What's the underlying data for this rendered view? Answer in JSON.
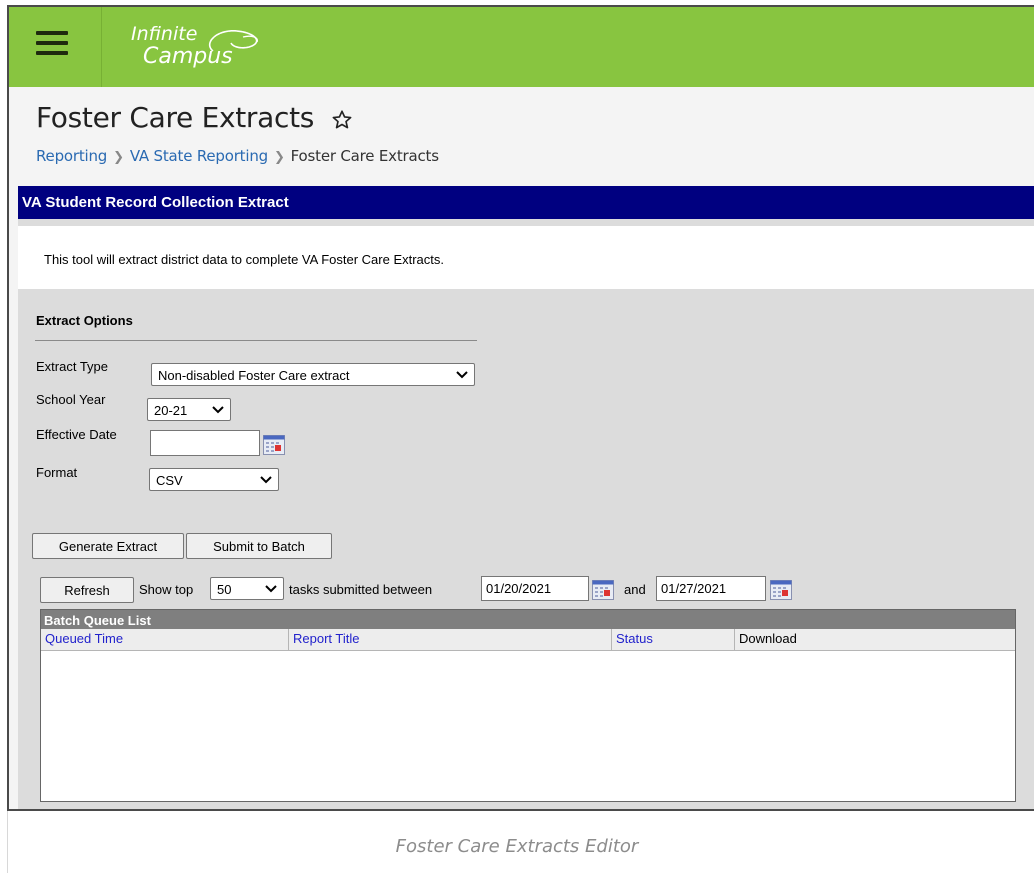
{
  "app": {
    "logo_line1": "Infinite",
    "logo_line2": "Campus"
  },
  "header": {
    "title": "Foster Care Extracts",
    "breadcrumb": [
      "Reporting",
      "VA State Reporting",
      "Foster Care Extracts"
    ]
  },
  "colors": {
    "topbar": "#88c540",
    "section_bar": "#000080",
    "link": "#2a6ab2"
  },
  "panel": {
    "title": "VA Student Record Collection Extract",
    "description": "This tool will extract district data to complete VA Foster Care Extracts."
  },
  "options": {
    "section_title": "Extract Options",
    "extract_type_label": "Extract Type",
    "extract_type_value": "Non-disabled Foster Care extract",
    "school_year_label": "School Year",
    "school_year_value": "20-21",
    "effective_date_label": "Effective Date",
    "effective_date_value": "",
    "format_label": "Format",
    "format_value": "CSV"
  },
  "actions": {
    "generate": "Generate Extract",
    "submit_batch": "Submit to Batch"
  },
  "batch": {
    "refresh": "Refresh",
    "show_top": "Show top",
    "top_value": "50",
    "between": "tasks submitted between",
    "start_date": "01/20/2021",
    "and": "and",
    "end_date": "01/27/2021",
    "list_title": "Batch Queue List",
    "columns": [
      "Queued Time",
      "Report Title",
      "Status",
      "Download"
    ]
  },
  "caption": "Foster Care Extracts Editor"
}
